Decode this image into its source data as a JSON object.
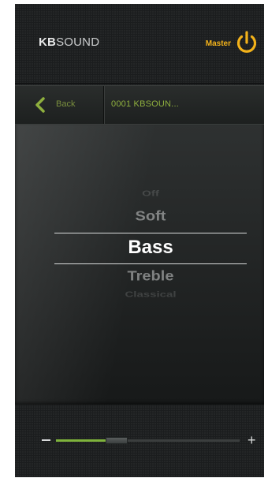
{
  "header": {
    "logo_bold": "KB",
    "logo_light": "SOUND",
    "master_label": "Master",
    "power_icon": "power-icon"
  },
  "nav": {
    "back_label": "Back",
    "back_icon": "chevron-left-icon",
    "device_name": "0001 KBSOUN..."
  },
  "picker": {
    "options": [
      "Off",
      "Soft",
      "Bass",
      "Treble",
      "Classical"
    ],
    "selected": "Bass"
  },
  "volume": {
    "minus_label": "−",
    "plus_label": "+",
    "level_percent": 33
  },
  "colors": {
    "accent_orange": "#f3b21a",
    "accent_green": "#7fb33c",
    "nav_text": "#8fb03e"
  }
}
